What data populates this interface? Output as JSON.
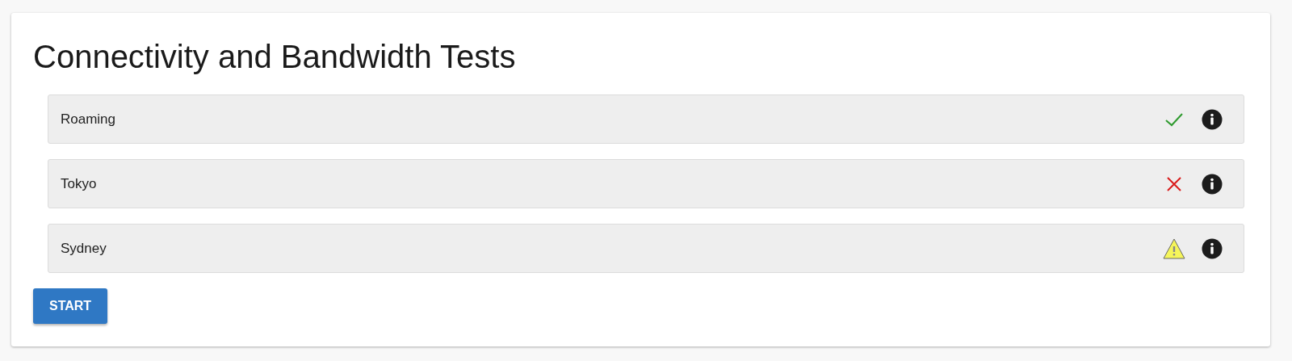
{
  "title": "Connectivity and Bandwidth Tests",
  "tests": [
    {
      "name": "Roaming",
      "kind": "pass"
    },
    {
      "name": "Tokyo",
      "kind": "fail"
    },
    {
      "name": "Sydney",
      "kind": "warning"
    }
  ],
  "start_button": "START"
}
